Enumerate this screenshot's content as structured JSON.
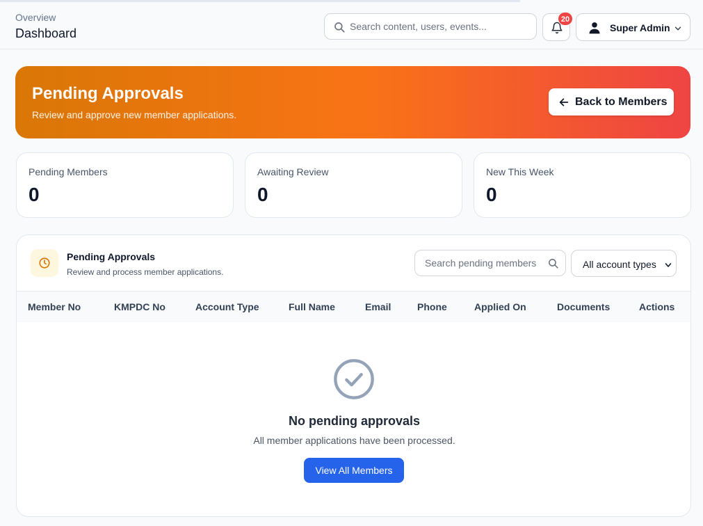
{
  "header": {
    "breadcrumb": "Overview",
    "title": "Dashboard",
    "search_placeholder": "Search content, users, events...",
    "notification_count": "20",
    "user_name": "Super Admin"
  },
  "banner": {
    "title": "Pending Approvals",
    "subtitle": "Review and approve new member applications.",
    "back_button": "Back to Members"
  },
  "stats": [
    {
      "label": "Pending Members",
      "value": "0"
    },
    {
      "label": "Awaiting Review",
      "value": "0"
    },
    {
      "label": "New This Week",
      "value": "0"
    }
  ],
  "panel": {
    "title": "Pending Approvals",
    "subtitle": "Review and process member applications.",
    "search_placeholder": "Search pending members",
    "filter_selected": "All account types",
    "columns": [
      "Member No",
      "KMPDC No",
      "Account Type",
      "Full Name",
      "Email",
      "Phone",
      "Applied On",
      "Documents",
      "Actions"
    ],
    "empty_title": "No pending approvals",
    "empty_subtitle": "All member applications have been processed.",
    "empty_button": "View All Members"
  },
  "colors": {
    "banner_gradient": [
      "#d97706",
      "#f97316",
      "#ef4444"
    ],
    "primary": "#2563eb",
    "badge": "#ef4444"
  },
  "icons": [
    "search-icon",
    "bell-icon",
    "user-icon",
    "chevron-down-icon",
    "arrow-left-icon",
    "clock-icon",
    "check-circle-icon"
  ]
}
